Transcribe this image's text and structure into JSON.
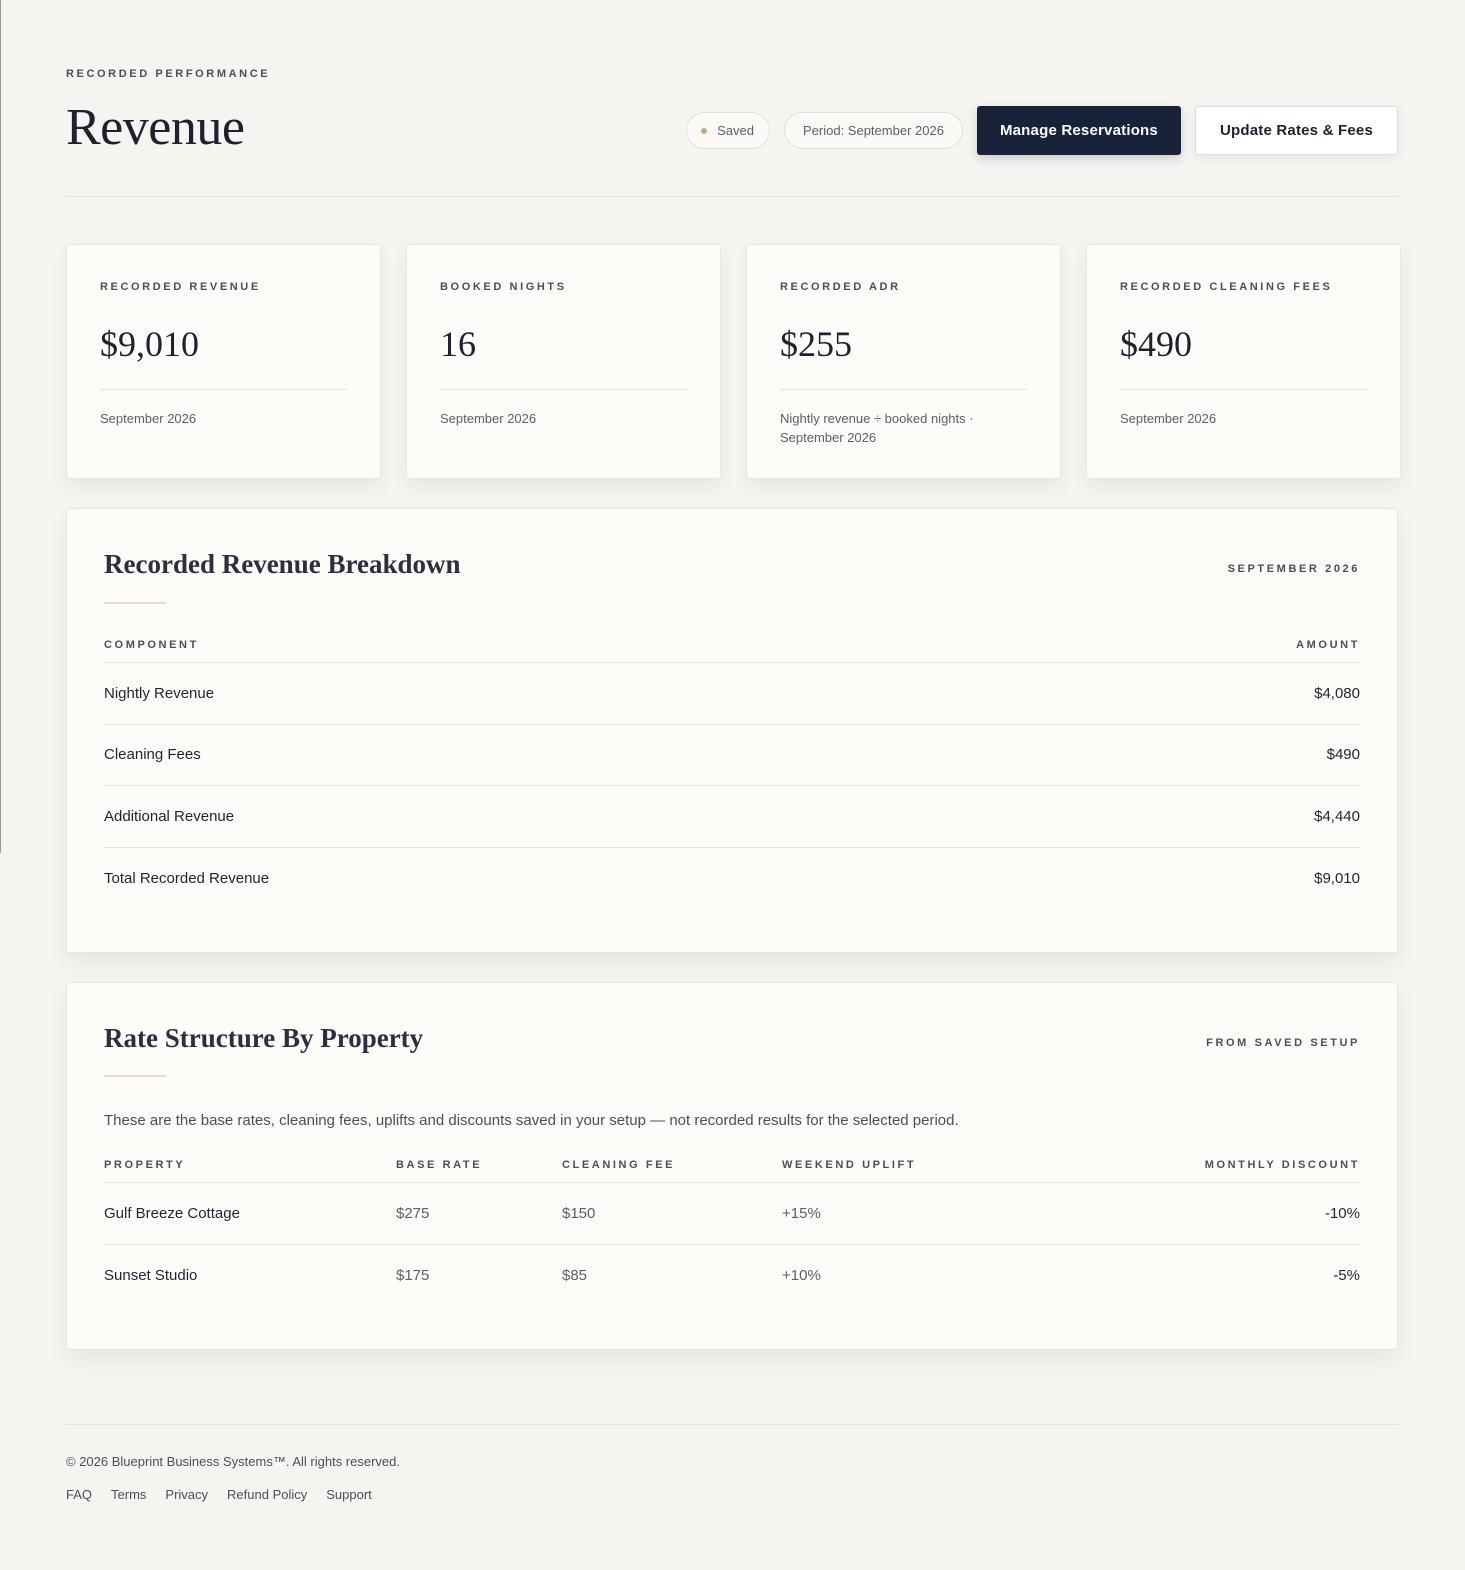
{
  "header": {
    "eyebrow": "RECORDED PERFORMANCE",
    "title": "Revenue",
    "status_label": "Saved",
    "period_label": "Period: September 2026",
    "primary_button": "Manage Reservations",
    "secondary_button": "Update Rates & Fees"
  },
  "kpis": [
    {
      "label": "RECORDED REVENUE",
      "value": "$9,010",
      "note": "September 2026"
    },
    {
      "label": "BOOKED NIGHTS",
      "value": "16",
      "note": "September 2026"
    },
    {
      "label": "RECORDED ADR",
      "value": "$255",
      "note": "Nightly revenue ÷ booked nights · September 2026"
    },
    {
      "label": "RECORDED CLEANING FEES",
      "value": "$490",
      "note": "September 2026"
    }
  ],
  "breakdown": {
    "title": "Recorded Revenue Breakdown",
    "tag": "SEPTEMBER 2026",
    "headers": [
      "COMPONENT",
      "AMOUNT"
    ],
    "rows": [
      {
        "component": "Nightly Revenue",
        "amount": "$4,080"
      },
      {
        "component": "Cleaning Fees",
        "amount": "$490"
      },
      {
        "component": "Additional Revenue",
        "amount": "$4,440"
      },
      {
        "component": "Total Recorded Revenue",
        "amount": "$9,010"
      }
    ]
  },
  "rates": {
    "title": "Rate Structure By Property",
    "tag": "FROM SAVED SETUP",
    "intro": "These are the base rates, cleaning fees, uplifts and discounts saved in your setup — not recorded results for the selected period.",
    "headers": [
      "PROPERTY",
      "BASE RATE",
      "CLEANING FEE",
      "WEEKEND UPLIFT",
      "MONTHLY DISCOUNT"
    ],
    "rows": [
      {
        "property": "Gulf Breeze Cottage",
        "base": "$275",
        "cleaning": "$150",
        "uplift": "+15%",
        "discount": "-10%"
      },
      {
        "property": "Sunset Studio",
        "base": "$175",
        "cleaning": "$85",
        "uplift": "+10%",
        "discount": "-5%"
      }
    ]
  },
  "footer": {
    "copyright": "© 2026 Blueprint Business Systems™. All rights reserved.",
    "links": [
      "FAQ",
      "Terms",
      "Privacy",
      "Refund Policy",
      "Support"
    ]
  },
  "colors": {
    "primary": "#18233a",
    "accent": "#c9a67a",
    "background": "#f5f4f1"
  }
}
